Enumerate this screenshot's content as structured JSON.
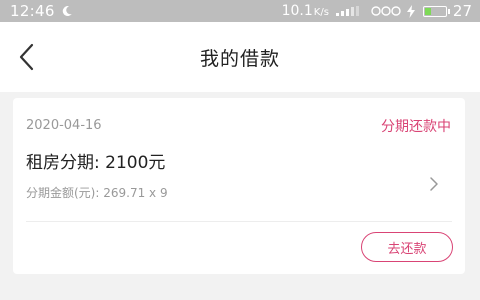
{
  "status_bar": {
    "time": "12:46",
    "network_speed": "10.1",
    "network_unit": "K/s",
    "battery_level": "27",
    "battery_fraction": 0.27
  },
  "header": {
    "title": "我的借款"
  },
  "loan_card": {
    "date": "2020-04-16",
    "status": "分期还款中",
    "title": "租房分期: 2100元",
    "detail": "分期金额(元): 269.71 x 9",
    "repay_button": "去还款"
  },
  "colors": {
    "accent": "#d94475",
    "status_bar_bg": "#bdbdbd",
    "page_bg": "#f2f2f2"
  },
  "icons": [
    "moon-icon",
    "signal-icon",
    "bluetooth-icon",
    "charging-icon",
    "battery-icon",
    "back-arrow-icon",
    "chevron-right-icon"
  ]
}
